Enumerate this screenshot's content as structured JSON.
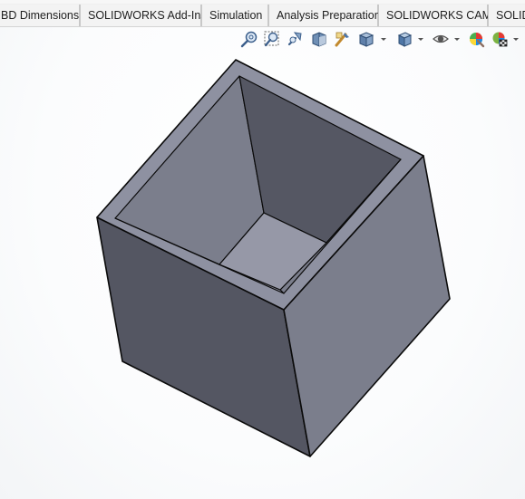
{
  "command_manager": {
    "tabs": [
      {
        "label": "BD Dimensions"
      },
      {
        "label": "SOLIDWORKS Add-Ins"
      },
      {
        "label": "Simulation"
      },
      {
        "label": "Analysis Preparation"
      },
      {
        "label": "SOLIDWORKS CAM"
      },
      {
        "label": "SOLID"
      }
    ]
  },
  "heads_up_toolbar": {
    "icons": [
      "zoom-to-fit-icon",
      "zoom-to-area-icon",
      "previous-view-icon",
      "section-view-icon",
      "dynamic-annotation-views-icon",
      "view-orientation-icon",
      "display-style-icon",
      "hide-show-items-icon",
      "edit-appearance-icon",
      "apply-scene-icon"
    ]
  },
  "colors": {
    "face_left": "#545662",
    "face_right": "#7b7e8c",
    "rim_top": "#8e91a1",
    "inner_wall_left": "#7b7e8c",
    "inner_wall_right": "#555763",
    "inner_floor": "#9698a7",
    "edge": "#0a0a0a"
  }
}
